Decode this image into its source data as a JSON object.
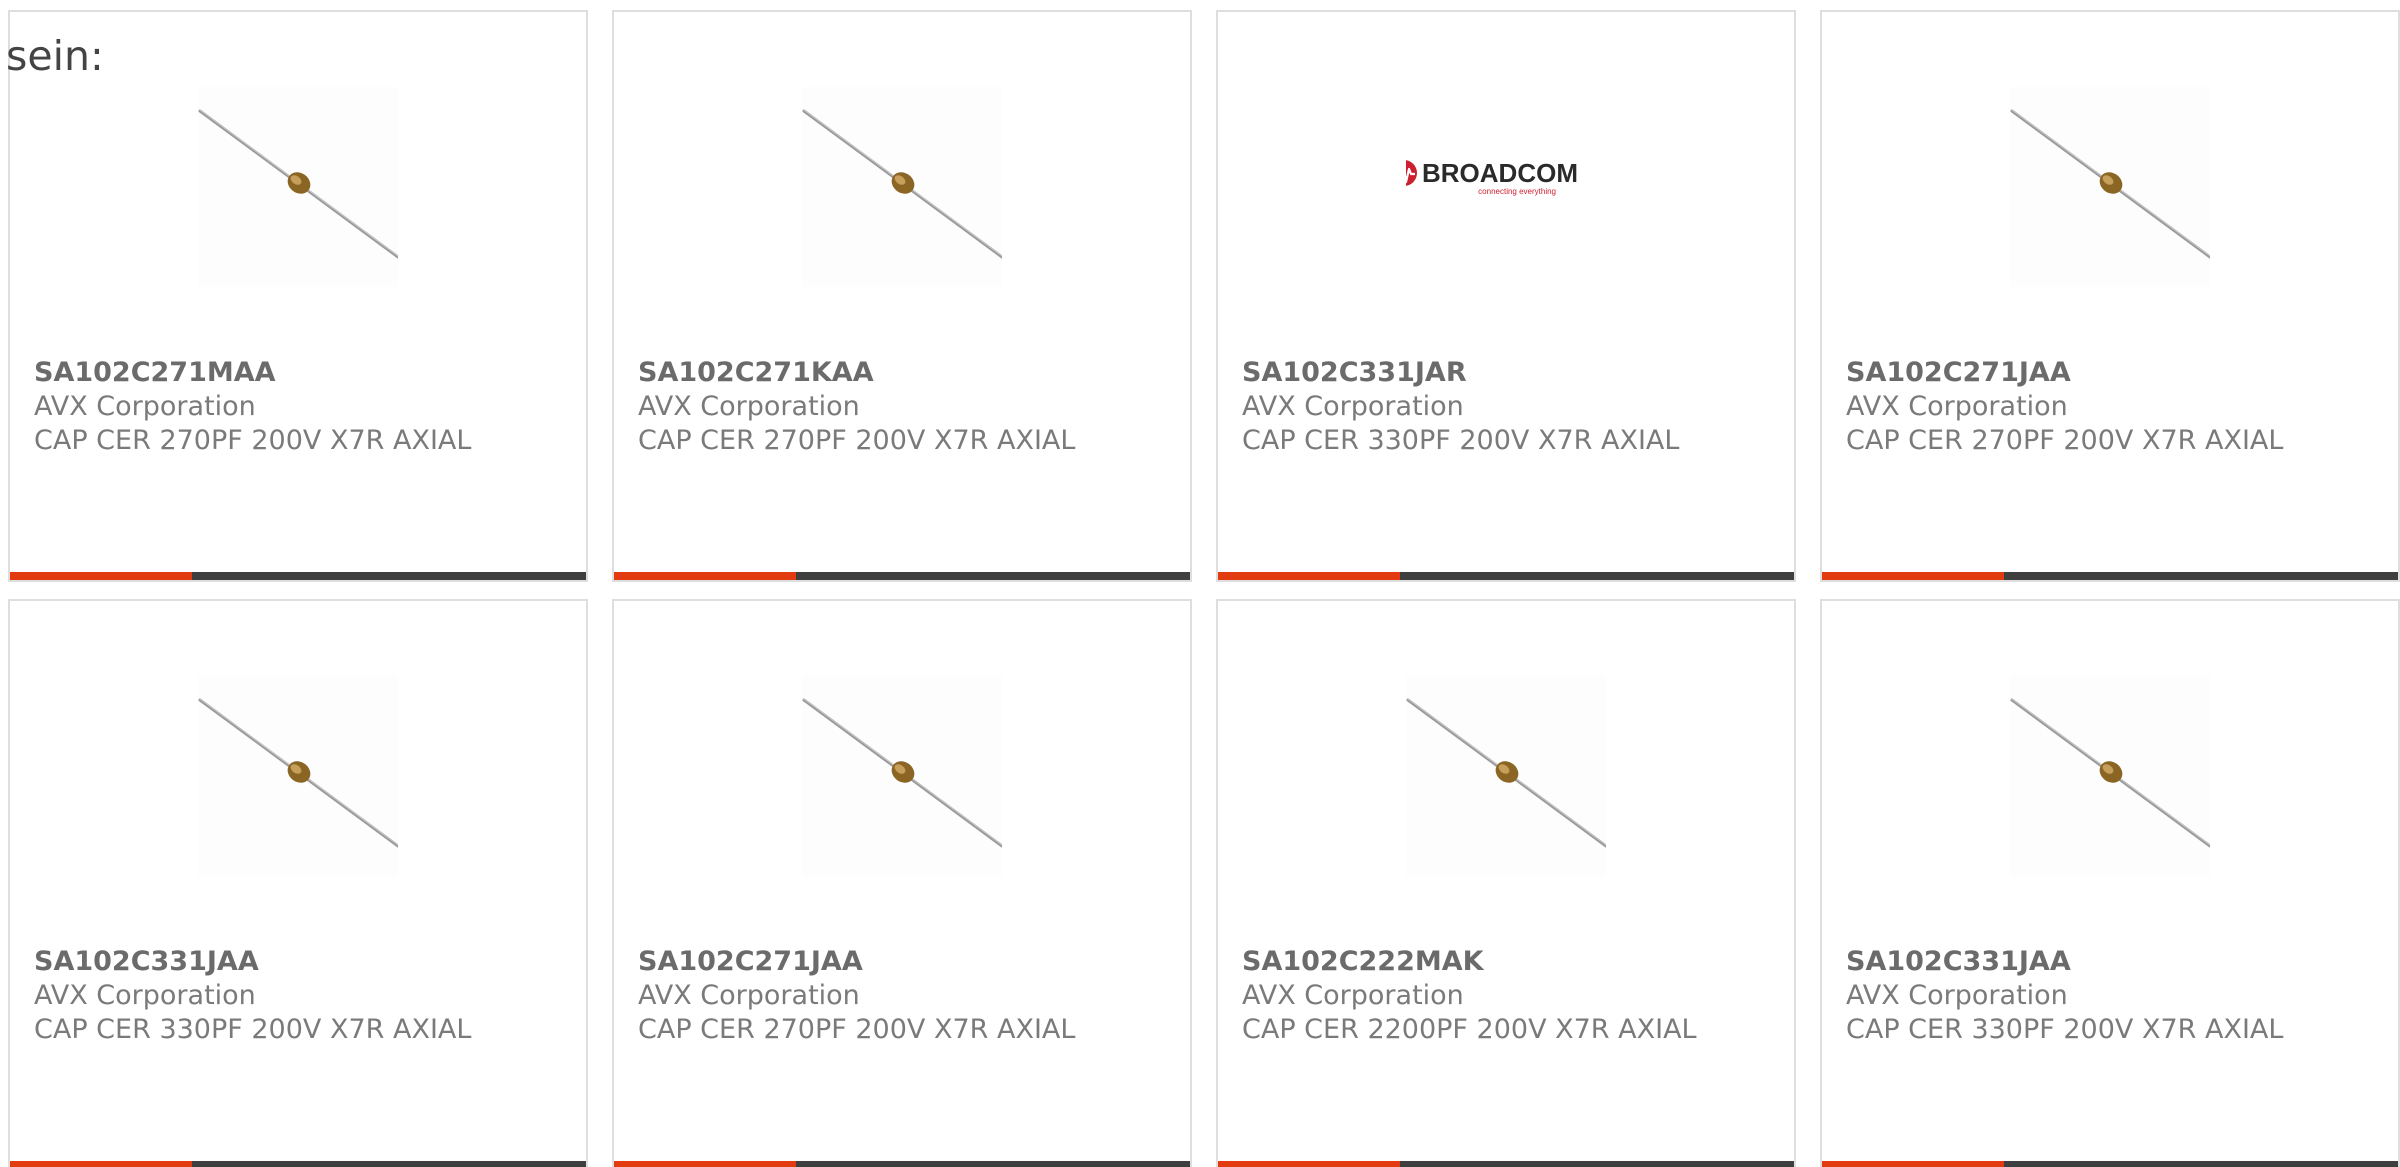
{
  "intro": {
    "text": "sein:"
  },
  "colors": {
    "accent": "#e33b10",
    "bar": "#3f3f3f",
    "text": "#7a7a7a",
    "border": "#dedede",
    "logo_red": "#cc1f2f"
  },
  "products": [
    {
      "part_number": "SA102C271MAA",
      "manufacturer": "AVX Corporation",
      "description": "CAP CER 270PF 200V X7R AXIAL",
      "image": "axial-capacitor"
    },
    {
      "part_number": "SA102C271KAA",
      "manufacturer": "AVX Corporation",
      "description": "CAP CER 270PF 200V X7R AXIAL",
      "image": "axial-capacitor"
    },
    {
      "part_number": "SA102C331JAR",
      "manufacturer": "AVX Corporation",
      "description": "CAP CER 330PF 200V X7R AXIAL",
      "image": "broadcom-logo",
      "logo_text": "BROADCOM",
      "logo_tagline": "connecting everything"
    },
    {
      "part_number": "SA102C271JAA",
      "manufacturer": "AVX Corporation",
      "description": "CAP CER 270PF 200V X7R AXIAL",
      "image": "axial-capacitor"
    },
    {
      "part_number": "SA102C331JAA",
      "manufacturer": "AVX Corporation",
      "description": "CAP CER 330PF 200V X7R AXIAL",
      "image": "axial-capacitor"
    },
    {
      "part_number": "SA102C271JAA",
      "manufacturer": "AVX Corporation",
      "description": "CAP CER 270PF 200V X7R AXIAL",
      "image": "axial-capacitor"
    },
    {
      "part_number": "SA102C222MAK",
      "manufacturer": "AVX Corporation",
      "description": "CAP CER 2200PF 200V X7R AXIAL",
      "image": "axial-capacitor"
    },
    {
      "part_number": "SA102C331JAA",
      "manufacturer": "AVX Corporation",
      "description": "CAP CER 330PF 200V X7R AXIAL",
      "image": "axial-capacitor"
    }
  ]
}
